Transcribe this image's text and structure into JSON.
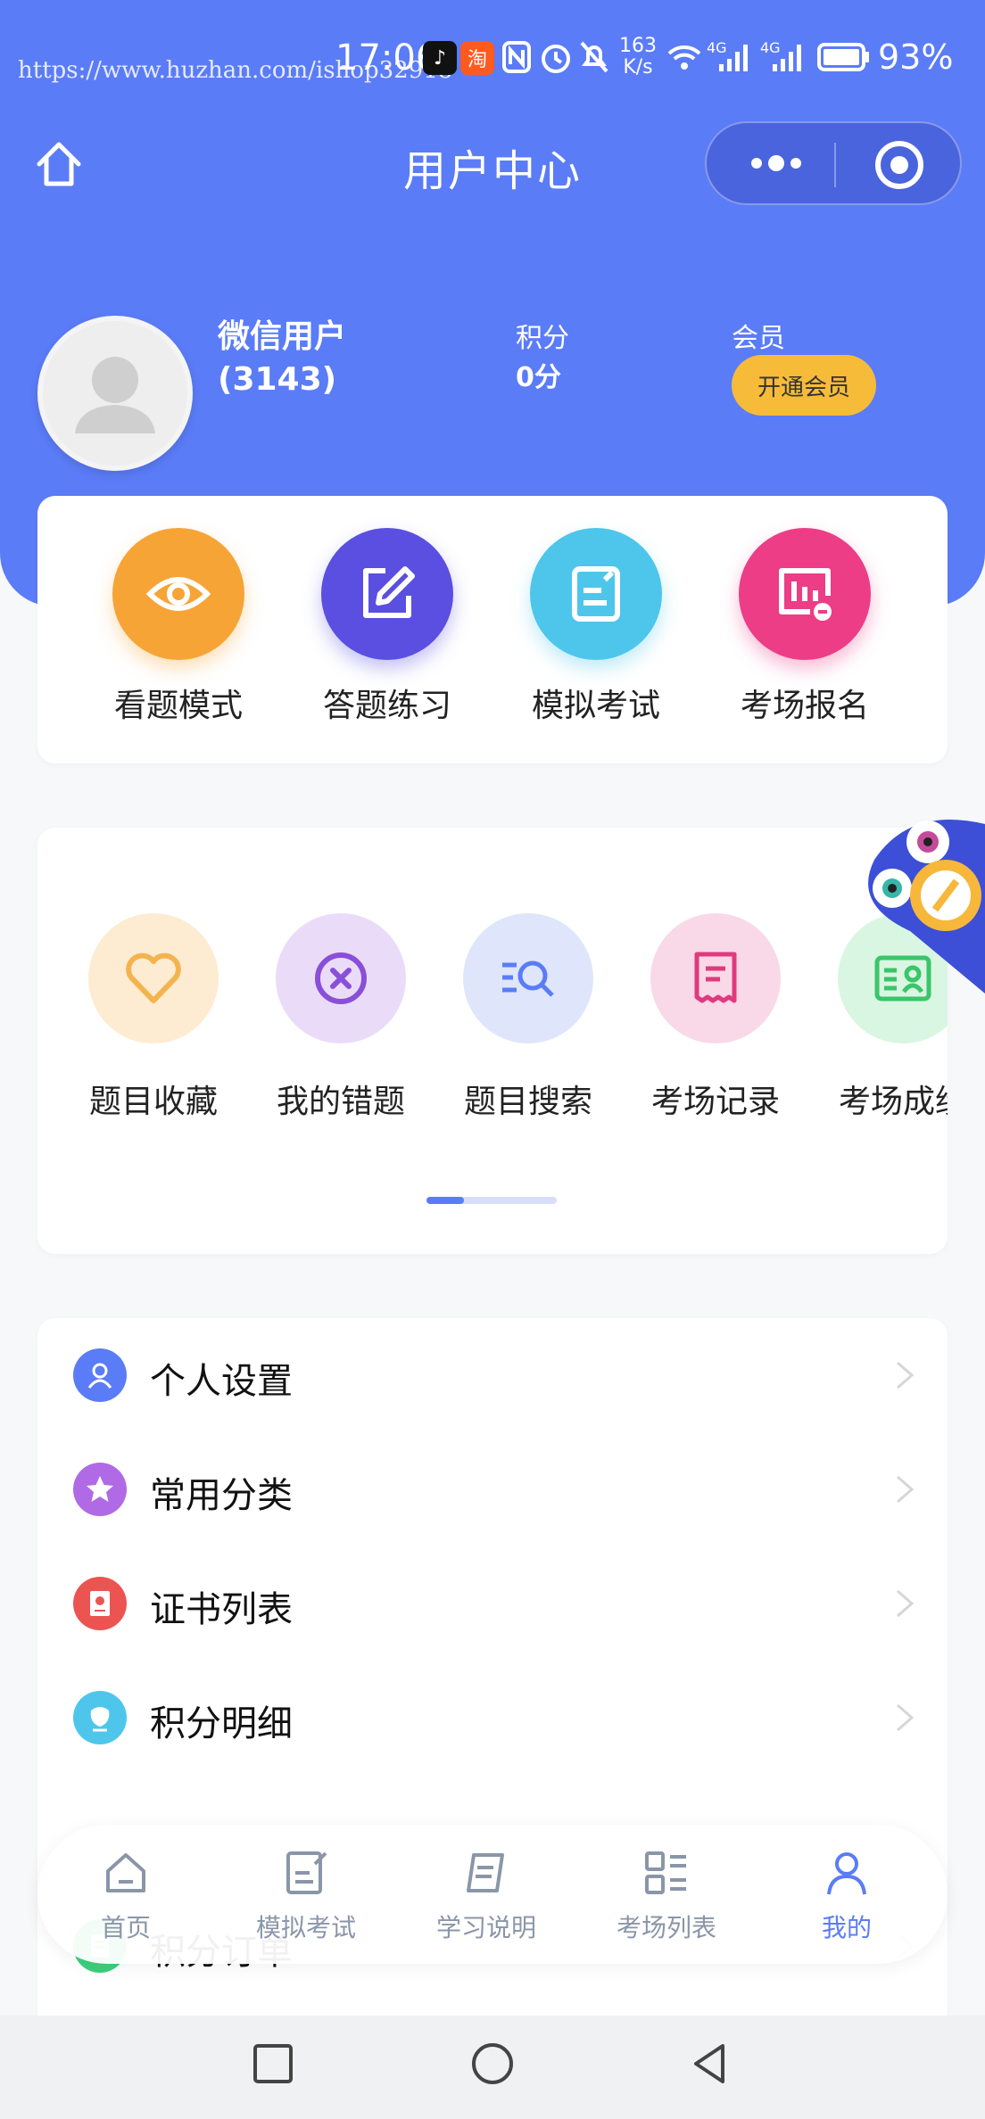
{
  "status_bar": {
    "watermark": "https://www.huzhan.com/ishop32918",
    "time": "17:06",
    "net_speed_value": "163",
    "net_speed_unit": "K/s",
    "signal_1": "4G",
    "signal_2": "4G",
    "battery": "93%"
  },
  "navbar": {
    "title": "用户中心",
    "home_icon": "home-icon",
    "more_icon": "more-dots-icon",
    "close_icon": "target-close-icon"
  },
  "profile": {
    "name_line1": "微信用户",
    "name_line2": "(3143)",
    "points_label": "积分",
    "points_value": "0分",
    "member_label": "会员",
    "member_button": "开通会员"
  },
  "modes": [
    {
      "label": "看题模式",
      "icon": "eye-icon",
      "color": "#f7a437"
    },
    {
      "label": "答题练习",
      "icon": "edit-icon",
      "color": "#5a4fe0"
    },
    {
      "label": "模拟考试",
      "icon": "exam-icon",
      "color": "#4ec6ec"
    },
    {
      "label": "考场报名",
      "icon": "signup-icon",
      "color": "#ec3d86"
    }
  ],
  "tools": [
    {
      "label": "题目收藏",
      "icon": "heart-icon",
      "color": "#f3b450",
      "bg": "#fdecd2"
    },
    {
      "label": "我的错题",
      "icon": "wrong-icon",
      "color": "#8a4fd8",
      "bg": "#eadcf8"
    },
    {
      "label": "题目搜索",
      "icon": "search-list-icon",
      "color": "#5b7cf7",
      "bg": "#dfe6fb"
    },
    {
      "label": "考场记录",
      "icon": "record-icon",
      "color": "#e03a7e",
      "bg": "#f9d9e7"
    },
    {
      "label": "考场成绩",
      "icon": "score-card-icon",
      "color": "#3cc46b",
      "bg": "#d9f6e2"
    }
  ],
  "menu": [
    {
      "label": "个人设置",
      "icon": "user-settings-icon",
      "color": "#5b7cf7"
    },
    {
      "label": "常用分类",
      "icon": "star-icon",
      "color": "#b06ae6"
    },
    {
      "label": "证书列表",
      "icon": "certificate-icon",
      "color": "#ec5452"
    },
    {
      "label": "积分明细",
      "icon": "points-detail-icon",
      "color": "#4ec6ec"
    },
    {
      "label": "积分订单",
      "icon": "order-icon",
      "color": "#3ccf7d"
    }
  ],
  "tabbar": [
    {
      "label": "首页",
      "icon": "home-tab-icon",
      "active": false
    },
    {
      "label": "模拟考试",
      "icon": "exam-tab-icon",
      "active": false
    },
    {
      "label": "学习说明",
      "icon": "study-tab-icon",
      "active": false
    },
    {
      "label": "考场列表",
      "icon": "list-tab-icon",
      "active": false
    },
    {
      "label": "我的",
      "icon": "profile-tab-icon",
      "active": true
    }
  ],
  "colors": {
    "primary": "#5b7cf7",
    "member_button": "#f7bb3a",
    "inactive_tab": "#8a96a8"
  }
}
